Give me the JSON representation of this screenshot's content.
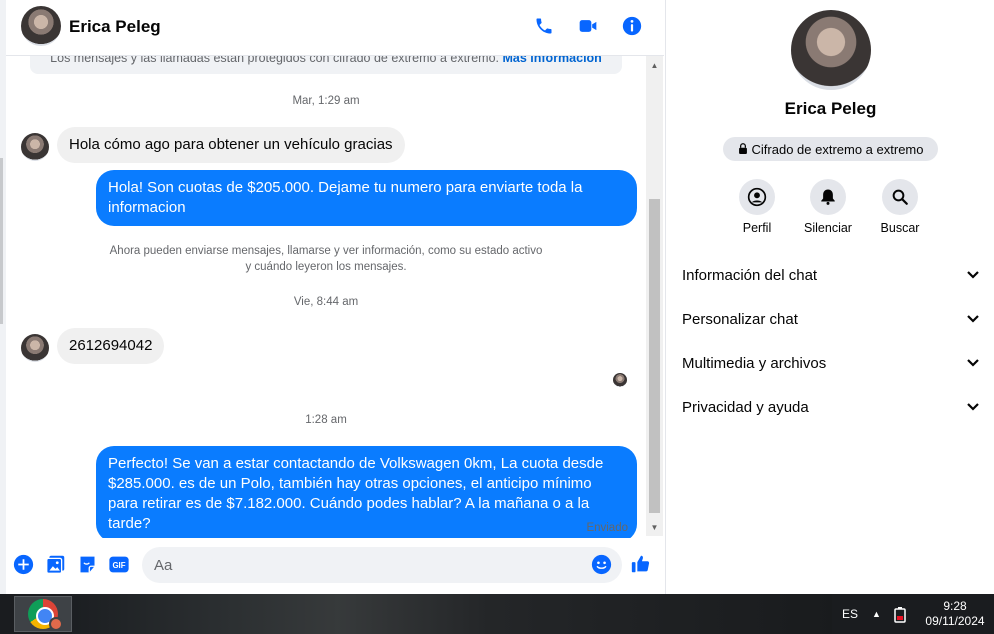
{
  "contact": {
    "name": "Erica Peleg"
  },
  "header": {
    "icons": [
      "phone-icon",
      "video-icon",
      "info-icon"
    ]
  },
  "banner": {
    "text": "Los mensajes y las llamadas están protegidos con cifrado de extremo a extremo.",
    "link": "Más información"
  },
  "messages": {
    "ts1": "Mar, 1:29 am",
    "m1": "Hola cómo ago para obtener un vehículo gracias",
    "m2": "Hola! Son cuotas de $205.000. Dejame tu numero para enviarte toda la informacion",
    "system": "Ahora pueden enviarse mensajes, llamarse y ver información, como su estado activo y cuándo leyeron los mensajes.",
    "ts2": "Vie, 8:44 am",
    "m3": "2612694042",
    "ts3": "1:28 am",
    "m4": "Perfecto!  Se van a estar contactando de Volkswagen 0km, La cuota desde $285.000. es de un Polo, también hay otras opciones, el anticipo mínimo para retirar es de $7.182.000. Cuándo podes hablar? A la mañana o a la tarde?",
    "status": "Enviado"
  },
  "composer": {
    "placeholder": "Aa"
  },
  "info_panel": {
    "name": "Erica Peleg",
    "e2e": "Cifrado de extremo a extremo",
    "actions": {
      "profile": "Perfil",
      "mute": "Silenciar",
      "search": "Buscar"
    },
    "sections": [
      "Información del chat",
      "Personalizar chat",
      "Multimedia y archivos",
      "Privacidad y ayuda"
    ]
  },
  "taskbar": {
    "lang": "ES",
    "time": "9:28",
    "date": "09/11/2024"
  },
  "colors": {
    "accent": "#0a7cff",
    "icon_blue": "#0866ff",
    "bubble_in": "#f0f0f0"
  }
}
